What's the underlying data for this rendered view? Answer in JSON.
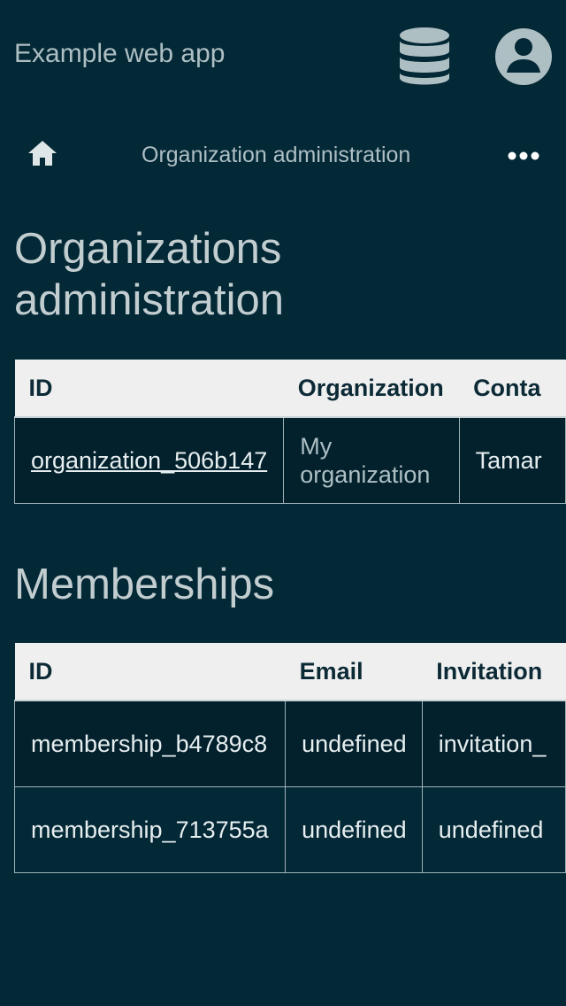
{
  "header": {
    "app_title": "Example web app",
    "database_icon": "database-icon",
    "account_icon": "account-circle-icon"
  },
  "nav": {
    "home_icon": "home-icon",
    "breadcrumb": "Organization administration",
    "more_icon": "more-horizontal-icon"
  },
  "organizations": {
    "heading": "Organizations administration",
    "columns": [
      "ID",
      "Organization",
      "Conta"
    ],
    "rows": [
      {
        "id": "organization_506b147",
        "name": "My organization",
        "contact": "Tamar"
      }
    ]
  },
  "memberships": {
    "heading": "Memberships",
    "columns": [
      "ID",
      "Email",
      "Invitation"
    ],
    "rows": [
      {
        "id": "membership_b4789c8",
        "email": "undefined",
        "invitation": "invitation_"
      },
      {
        "id": "membership_713755a",
        "email": "undefined",
        "invitation": "undefined"
      }
    ]
  },
  "colors": {
    "background": "#032836",
    "table_header": "#efefef",
    "row_dark": "#02212c"
  }
}
